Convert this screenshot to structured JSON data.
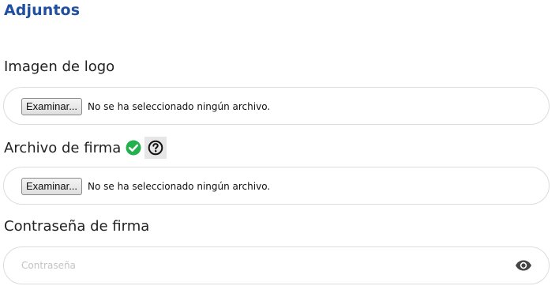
{
  "section": {
    "title": "Adjuntos"
  },
  "logo": {
    "label": "Imagen de logo",
    "button_label": "Examinar...",
    "status_text": "No se ha seleccionado ningún archivo."
  },
  "signature_file": {
    "label": "Archivo de firma",
    "status_icon": "check-circle-icon",
    "status_color": "#22b14c",
    "help_icon": "question-circle-icon",
    "button_label": "Examinar...",
    "status_text": "No se ha seleccionado ningún archivo."
  },
  "signature_password": {
    "label": "Contraseña de firma",
    "placeholder": "Contraseña",
    "value": "",
    "toggle_icon": "eye-icon"
  },
  "colors": {
    "title": "#1f4fa0",
    "label": "#222222",
    "border": "#dcdcdc"
  }
}
